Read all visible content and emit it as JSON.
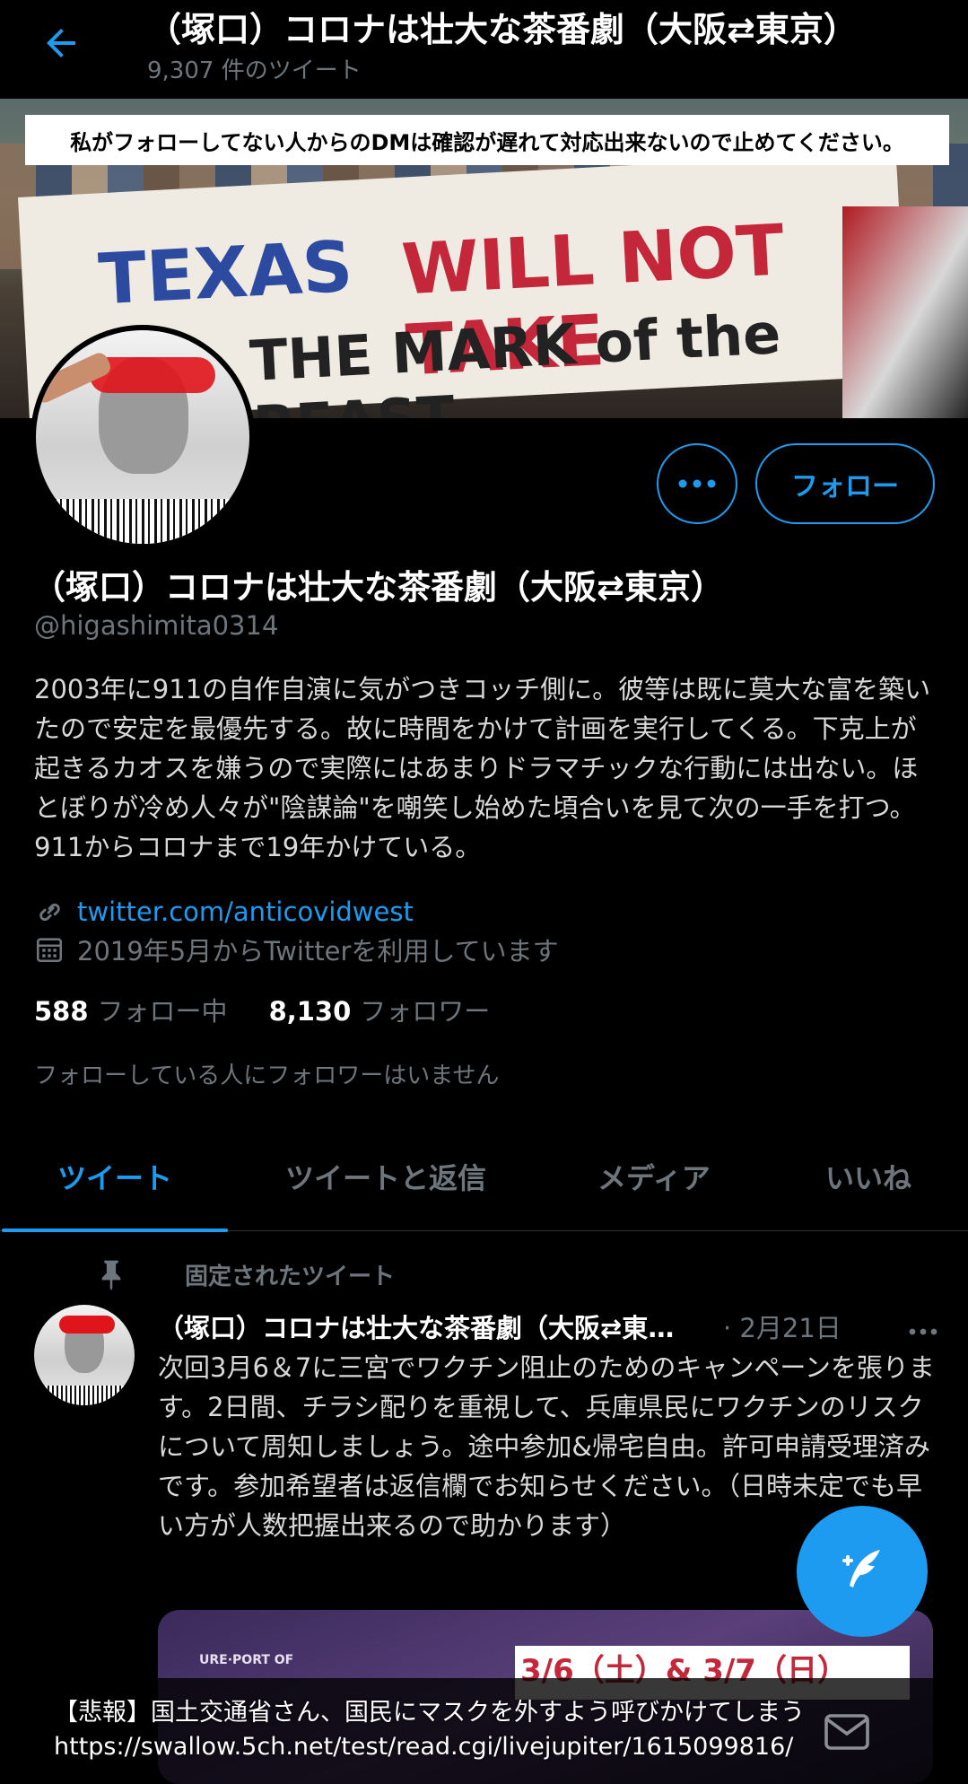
{
  "header": {
    "title": "（塚口）コロナは壮大な茶番劇（大阪⇄東京）",
    "tweet_count": "9,307 件のツイート"
  },
  "banner": {
    "notice": "私がフォローしてない人からのDMは確認が遅れて対応出来ないので止めてください。",
    "sign_line1a": "TEXAS",
    "sign_line1b": "WILL NOT TAKE",
    "sign_line2": "THE MARK of the BEAST"
  },
  "actions": {
    "more_icon": "more-horizontal-icon",
    "follow_label": "フォロー"
  },
  "profile": {
    "display_name": "（塚口）コロナは壮大な茶番劇（大阪⇄東京）",
    "handle": "@higashimita0314",
    "bio": "2003年に911の自作自演に気がつきコッチ側に。彼等は既に莫大な富を築いたので安定を最優先する。故に時間をかけて計画を実行してくる。下克上が起きるカオスを嫌うので実際にはあまりドラマチックな行動には出ない。ほとぼりが冷め人々が\"陰謀論\"を嘲笑し始めた頃合いを見て次の一手を打つ。911からコロナまで19年かけている。",
    "link": "twitter.com/anticovidwest",
    "joined": "2019年5月からTwitterを利用しています",
    "following_count": "588",
    "following_label": "フォロー中",
    "followers_count": "8,130",
    "followers_label": "フォロワー",
    "known_followers": "フォローしている人にフォロワーはいません"
  },
  "tabs": [
    {
      "label": "ツイート",
      "active": true
    },
    {
      "label": "ツイートと返信",
      "active": false
    },
    {
      "label": "メディア",
      "active": false
    },
    {
      "label": "いいね",
      "active": false
    }
  ],
  "pinned_tweet": {
    "pinned_label": "固定されたツイート",
    "author": "（塚口）コロナは壮大な茶番劇（大阪⇄東京）",
    "date": "· 2月21日",
    "body": "次回3月6＆7に三宮でワクチン阻止のためのキャンペーンを張ります。2日間、チラシ配りを重視して、兵庫県民にワクチンのリスクについて周知しましょう。途中参加&帰宅自由。許可申請受理済みです。参加希望者は返信欄でお知らせください。（日時未定でも早い方が人数把握出来るので助かります）",
    "media_label": "URE·PORT OF",
    "media_date": "3/6（土）& 3/7（日）"
  },
  "overlay_caption": {
    "line1": "【悲報】国土交通省さん、国民にマスクを外すよう呼びかけてしまう",
    "line2": "https://swallow.5ch.net/test/read.cgi/livejupiter/1615099816/"
  },
  "colors": {
    "accent": "#1d9bf0",
    "background": "#000000",
    "secondary_text": "#6e767d"
  }
}
